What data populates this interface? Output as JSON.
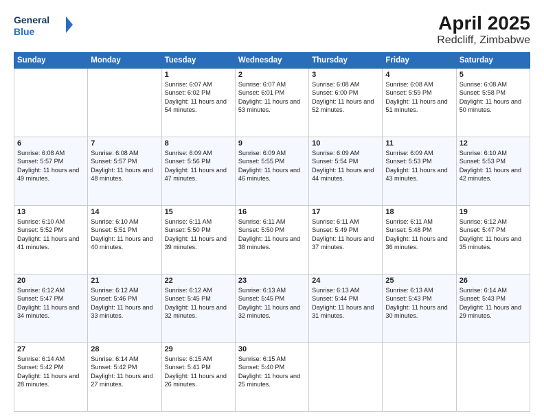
{
  "header": {
    "logo_line1": "General",
    "logo_line2": "Blue",
    "title": "April 2025",
    "subtitle": "Redcliff, Zimbabwe"
  },
  "days_of_week": [
    "Sunday",
    "Monday",
    "Tuesday",
    "Wednesday",
    "Thursday",
    "Friday",
    "Saturday"
  ],
  "weeks": [
    [
      {
        "day": "",
        "info": ""
      },
      {
        "day": "",
        "info": ""
      },
      {
        "day": "1",
        "info": "Sunrise: 6:07 AM\nSunset: 6:02 PM\nDaylight: 11 hours and 54 minutes."
      },
      {
        "day": "2",
        "info": "Sunrise: 6:07 AM\nSunset: 6:01 PM\nDaylight: 11 hours and 53 minutes."
      },
      {
        "day": "3",
        "info": "Sunrise: 6:08 AM\nSunset: 6:00 PM\nDaylight: 11 hours and 52 minutes."
      },
      {
        "day": "4",
        "info": "Sunrise: 6:08 AM\nSunset: 5:59 PM\nDaylight: 11 hours and 51 minutes."
      },
      {
        "day": "5",
        "info": "Sunrise: 6:08 AM\nSunset: 5:58 PM\nDaylight: 11 hours and 50 minutes."
      }
    ],
    [
      {
        "day": "6",
        "info": "Sunrise: 6:08 AM\nSunset: 5:57 PM\nDaylight: 11 hours and 49 minutes."
      },
      {
        "day": "7",
        "info": "Sunrise: 6:08 AM\nSunset: 5:57 PM\nDaylight: 11 hours and 48 minutes."
      },
      {
        "day": "8",
        "info": "Sunrise: 6:09 AM\nSunset: 5:56 PM\nDaylight: 11 hours and 47 minutes."
      },
      {
        "day": "9",
        "info": "Sunrise: 6:09 AM\nSunset: 5:55 PM\nDaylight: 11 hours and 46 minutes."
      },
      {
        "day": "10",
        "info": "Sunrise: 6:09 AM\nSunset: 5:54 PM\nDaylight: 11 hours and 44 minutes."
      },
      {
        "day": "11",
        "info": "Sunrise: 6:09 AM\nSunset: 5:53 PM\nDaylight: 11 hours and 43 minutes."
      },
      {
        "day": "12",
        "info": "Sunrise: 6:10 AM\nSunset: 5:53 PM\nDaylight: 11 hours and 42 minutes."
      }
    ],
    [
      {
        "day": "13",
        "info": "Sunrise: 6:10 AM\nSunset: 5:52 PM\nDaylight: 11 hours and 41 minutes."
      },
      {
        "day": "14",
        "info": "Sunrise: 6:10 AM\nSunset: 5:51 PM\nDaylight: 11 hours and 40 minutes."
      },
      {
        "day": "15",
        "info": "Sunrise: 6:11 AM\nSunset: 5:50 PM\nDaylight: 11 hours and 39 minutes."
      },
      {
        "day": "16",
        "info": "Sunrise: 6:11 AM\nSunset: 5:50 PM\nDaylight: 11 hours and 38 minutes."
      },
      {
        "day": "17",
        "info": "Sunrise: 6:11 AM\nSunset: 5:49 PM\nDaylight: 11 hours and 37 minutes."
      },
      {
        "day": "18",
        "info": "Sunrise: 6:11 AM\nSunset: 5:48 PM\nDaylight: 11 hours and 36 minutes."
      },
      {
        "day": "19",
        "info": "Sunrise: 6:12 AM\nSunset: 5:47 PM\nDaylight: 11 hours and 35 minutes."
      }
    ],
    [
      {
        "day": "20",
        "info": "Sunrise: 6:12 AM\nSunset: 5:47 PM\nDaylight: 11 hours and 34 minutes."
      },
      {
        "day": "21",
        "info": "Sunrise: 6:12 AM\nSunset: 5:46 PM\nDaylight: 11 hours and 33 minutes."
      },
      {
        "day": "22",
        "info": "Sunrise: 6:12 AM\nSunset: 5:45 PM\nDaylight: 11 hours and 32 minutes."
      },
      {
        "day": "23",
        "info": "Sunrise: 6:13 AM\nSunset: 5:45 PM\nDaylight: 11 hours and 32 minutes."
      },
      {
        "day": "24",
        "info": "Sunrise: 6:13 AM\nSunset: 5:44 PM\nDaylight: 11 hours and 31 minutes."
      },
      {
        "day": "25",
        "info": "Sunrise: 6:13 AM\nSunset: 5:43 PM\nDaylight: 11 hours and 30 minutes."
      },
      {
        "day": "26",
        "info": "Sunrise: 6:14 AM\nSunset: 5:43 PM\nDaylight: 11 hours and 29 minutes."
      }
    ],
    [
      {
        "day": "27",
        "info": "Sunrise: 6:14 AM\nSunset: 5:42 PM\nDaylight: 11 hours and 28 minutes."
      },
      {
        "day": "28",
        "info": "Sunrise: 6:14 AM\nSunset: 5:42 PM\nDaylight: 11 hours and 27 minutes."
      },
      {
        "day": "29",
        "info": "Sunrise: 6:15 AM\nSunset: 5:41 PM\nDaylight: 11 hours and 26 minutes."
      },
      {
        "day": "30",
        "info": "Sunrise: 6:15 AM\nSunset: 5:40 PM\nDaylight: 11 hours and 25 minutes."
      },
      {
        "day": "",
        "info": ""
      },
      {
        "day": "",
        "info": ""
      },
      {
        "day": "",
        "info": ""
      }
    ]
  ]
}
